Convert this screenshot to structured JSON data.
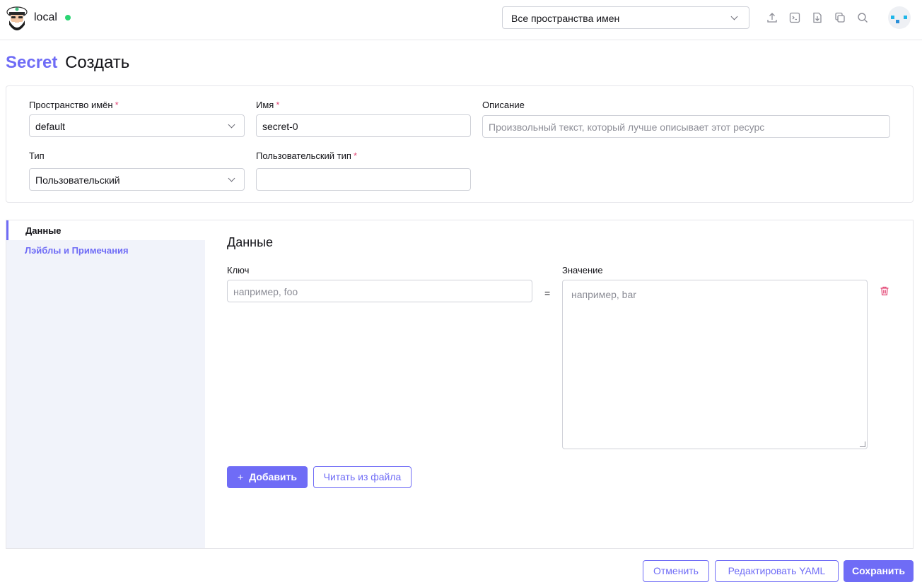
{
  "header": {
    "cluster_name": "local",
    "namespace_filter": "Все пространства имен",
    "icons": [
      "upload-icon",
      "terminal-icon",
      "download-icon",
      "copy-icon",
      "search-icon"
    ],
    "status_color": "#2bd573"
  },
  "page": {
    "resource": "Secret",
    "action": "Создать"
  },
  "form": {
    "namespace_label": "Пространство имён",
    "namespace_value": "default",
    "name_label": "Имя",
    "name_value": "secret-0",
    "description_label": "Описание",
    "description_placeholder": "Произвольный текст, который лучше описывает этот ресурс",
    "type_label": "Тип",
    "type_value": "Пользовательский",
    "custom_type_label": "Пользовательский тип",
    "custom_type_value": "",
    "required_mark": "*"
  },
  "tabs": [
    {
      "label": "Данные",
      "active": true
    },
    {
      "label": "Лэйблы и Примечания",
      "active": false
    }
  ],
  "data_section": {
    "title": "Данные",
    "key_label": "Ключ",
    "value_label": "Значение",
    "key_placeholder": "например, foo",
    "value_placeholder": "например, bar",
    "equals": "=",
    "add_button": "Добавить",
    "add_icon": "+",
    "read_file_button": "Читать из файла"
  },
  "footer": {
    "cancel": "Отменить",
    "edit_yaml": "Редактировать YAML",
    "save": "Сохранить"
  },
  "colors": {
    "accent": "#6f6cf6",
    "required": "#e34a78",
    "danger": "#e34a78"
  }
}
